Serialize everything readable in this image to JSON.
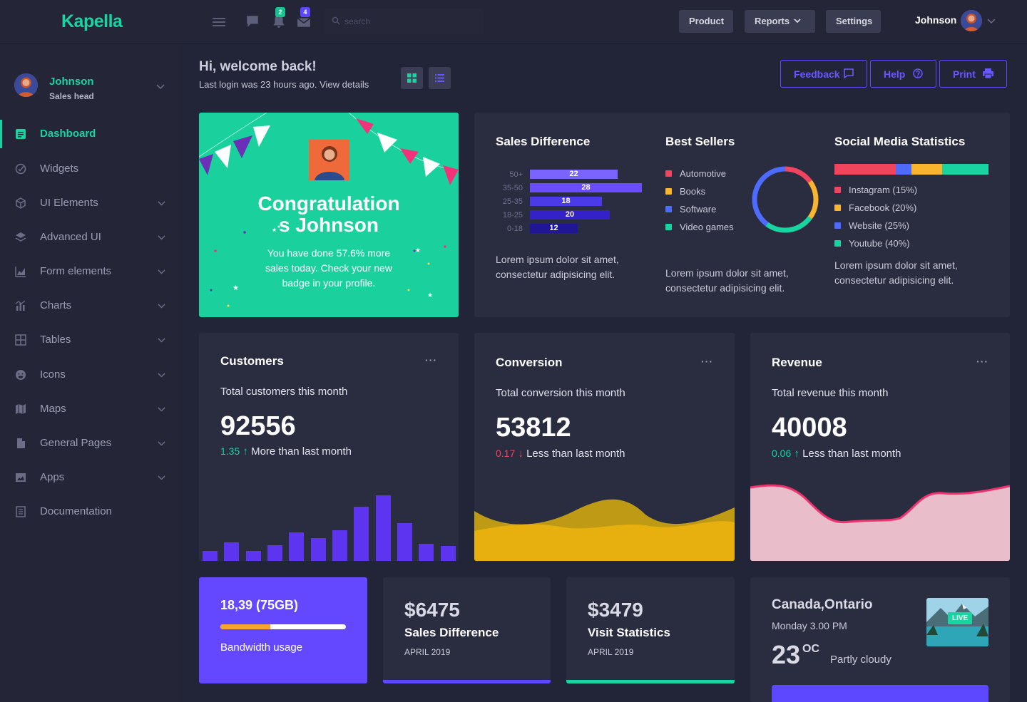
{
  "brand": "Kapella",
  "topbar": {
    "notifications_count": "2",
    "messages_count": "4",
    "search_placeholder": "search",
    "buttons": [
      "Product",
      "Reports",
      "Settings"
    ],
    "user_name": "Johnson"
  },
  "sidebar": {
    "user_name": "Johnson",
    "user_role": "Sales head",
    "items": [
      {
        "label": "Dashboard",
        "icon": "dashboard-icon",
        "active": true
      },
      {
        "label": "Widgets",
        "icon": "widgets-icon"
      },
      {
        "label": "UI Elements",
        "icon": "cube-icon"
      },
      {
        "label": "Advanced UI",
        "icon": "layers-icon"
      },
      {
        "label": "Form elements",
        "icon": "area-chart-icon"
      },
      {
        "label": "Charts",
        "icon": "bar-chart-icon"
      },
      {
        "label": "Tables",
        "icon": "table-icon"
      },
      {
        "label": "Icons",
        "icon": "smiley-icon"
      },
      {
        "label": "Maps",
        "icon": "map-icon"
      },
      {
        "label": "General Pages",
        "icon": "file-icon"
      },
      {
        "label": "Apps",
        "icon": "image-icon"
      },
      {
        "label": "Documentation",
        "icon": "document-icon"
      }
    ]
  },
  "header": {
    "greeting": "Hi, welcome back!",
    "subtitle": "Last login was 23 hours ago. View details",
    "actions": [
      "Feedback",
      "Help",
      "Print"
    ]
  },
  "congrats": {
    "title_line1": "Congratulation",
    "title_line2": "s Johnson",
    "text": "You have done 57.6% more sales today. Check your new badge in your profile."
  },
  "sales_difference": {
    "title": "Sales Difference",
    "description": "Lorem ipsum dolor sit amet, consectetur adipisicing elit.",
    "rows": [
      {
        "label": "50+",
        "value": 22
      },
      {
        "label": "35-50",
        "value": 28
      },
      {
        "label": "25-35",
        "value": 18
      },
      {
        "label": "18-25",
        "value": 20
      },
      {
        "label": "0-18",
        "value": 12
      }
    ]
  },
  "best_sellers": {
    "title": "Best Sellers",
    "description": "Lorem ipsum dolor sit amet, consectetur adipisicing elit.",
    "items": [
      {
        "label": "Automotive",
        "color": "#f0445f"
      },
      {
        "label": "Books",
        "color": "#f9b52e"
      },
      {
        "label": "Software",
        "color": "#4d6bff"
      },
      {
        "label": "Video games",
        "color": "#19d4a0"
      }
    ]
  },
  "social_media": {
    "title": "Social Media Statistics",
    "description": "Lorem ipsum dolor sit amet, consectetur adipisicing elit.",
    "items": [
      {
        "label": "Instagram (15%)",
        "color": "#f0445f"
      },
      {
        "label": "Facebook (20%)",
        "color": "#f9b52e"
      },
      {
        "label": "Website (25%)",
        "color": "#4d6bff"
      },
      {
        "label": "Youtube (40%)",
        "color": "#19d4a0"
      }
    ]
  },
  "kpis": [
    {
      "title": "Customers",
      "subtitle": "Total customers this month",
      "value": "92556",
      "change": "1.35",
      "direction": "up",
      "change_text": "More than last month",
      "bars": [
        14,
        26,
        14,
        22,
        40,
        32,
        43,
        76,
        92,
        53,
        24,
        21
      ]
    },
    {
      "title": "Conversion",
      "subtitle": "Total conversion this month",
      "value": "53812",
      "change": "0.17",
      "direction": "down",
      "change_text": "Less than last month"
    },
    {
      "title": "Revenue",
      "subtitle": "Total revenue this month",
      "value": "40008",
      "change": "0.06",
      "direction": "up",
      "change_text": "Less than last month"
    }
  ],
  "bandwidth": {
    "title": "18,39 (75GB)",
    "label": "Bandwidth usage",
    "usage_fraction": 0.4
  },
  "mini_cards": [
    {
      "amount": "$6475",
      "label": "Sales Difference",
      "date": "APRIL 2019",
      "accent": "#5d48ff"
    },
    {
      "amount": "$3479",
      "label": "Visit Statistics",
      "date": "APRIL 2019",
      "accent": "#19d4a0"
    }
  ],
  "weather": {
    "location": "Canada,Ontario",
    "time": "Monday 3.00 PM",
    "temperature": "23",
    "unit": "OC",
    "condition": "Partly cloudy",
    "live_label": "LIVE"
  }
}
